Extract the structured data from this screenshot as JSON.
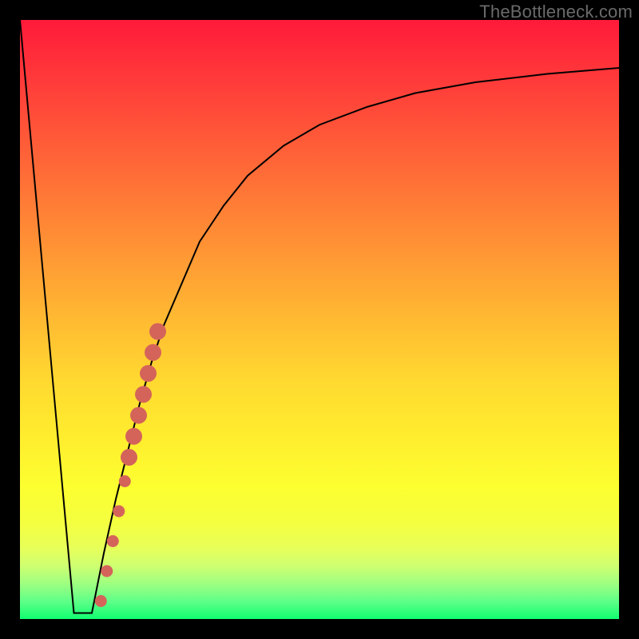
{
  "watermark": "TheBottleneck.com",
  "chart_data": {
    "type": "line",
    "title": "",
    "xlabel": "",
    "ylabel": "",
    "xlim": [
      0,
      100
    ],
    "ylim": [
      0,
      100
    ],
    "series": [
      {
        "name": "descending-segment",
        "x": [
          0,
          9
        ],
        "y": [
          100,
          1
        ]
      },
      {
        "name": "flat-segment",
        "x": [
          9,
          12
        ],
        "y": [
          1,
          1
        ]
      },
      {
        "name": "ascending-curve",
        "x": [
          12,
          14,
          16,
          18,
          20,
          22,
          24,
          27,
          30,
          34,
          38,
          44,
          50,
          58,
          66,
          76,
          88,
          100
        ],
        "y": [
          1,
          11,
          20,
          28,
          36,
          43,
          49,
          56,
          63,
          69,
          74,
          79,
          82.5,
          85.5,
          87.8,
          89.6,
          91,
          92
        ]
      }
    ],
    "markers": [
      {
        "x": 13.5,
        "y": 3.0,
        "r": 1.0
      },
      {
        "x": 14.5,
        "y": 8.0,
        "r": 1.0
      },
      {
        "x": 15.5,
        "y": 13.0,
        "r": 1.0
      },
      {
        "x": 16.5,
        "y": 18.0,
        "r": 1.0
      },
      {
        "x": 17.5,
        "y": 23.0,
        "r": 1.0
      },
      {
        "x": 18.2,
        "y": 27.0,
        "r": 1.4
      },
      {
        "x": 19.0,
        "y": 30.5,
        "r": 1.4
      },
      {
        "x": 19.8,
        "y": 34.0,
        "r": 1.4
      },
      {
        "x": 20.6,
        "y": 37.5,
        "r": 1.4
      },
      {
        "x": 21.4,
        "y": 41.0,
        "r": 1.4
      },
      {
        "x": 22.2,
        "y": 44.5,
        "r": 1.4
      },
      {
        "x": 23.0,
        "y": 48.0,
        "r": 1.4
      }
    ],
    "colors": {
      "line": "#000000",
      "marker": "#d4645a"
    }
  }
}
